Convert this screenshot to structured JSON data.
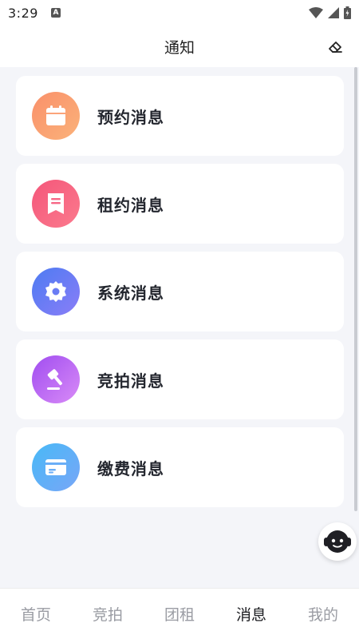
{
  "status_bar": {
    "time": "3:29",
    "notification_icon": "a-badge-icon"
  },
  "header": {
    "title": "通知",
    "action_icon": "eraser-icon"
  },
  "notifications": [
    {
      "label": "预约消息",
      "icon": "calendar-icon",
      "color": "#f9906a"
    },
    {
      "label": "租约消息",
      "icon": "document-icon",
      "color": "#f4567a"
    },
    {
      "label": "系统消息",
      "icon": "gear-icon",
      "color": "#4d7cf2"
    },
    {
      "label": "竞拍消息",
      "icon": "gavel-icon",
      "color": "#a04df0"
    },
    {
      "label": "缴费消息",
      "icon": "card-icon",
      "color": "#48b9f7"
    }
  ],
  "support": {
    "icon": "customer-service-icon"
  },
  "tabbar": {
    "tabs": [
      {
        "label": "首页"
      },
      {
        "label": "竞拍"
      },
      {
        "label": "团租"
      },
      {
        "label": "消息"
      },
      {
        "label": "我的"
      }
    ],
    "active": "消息"
  }
}
